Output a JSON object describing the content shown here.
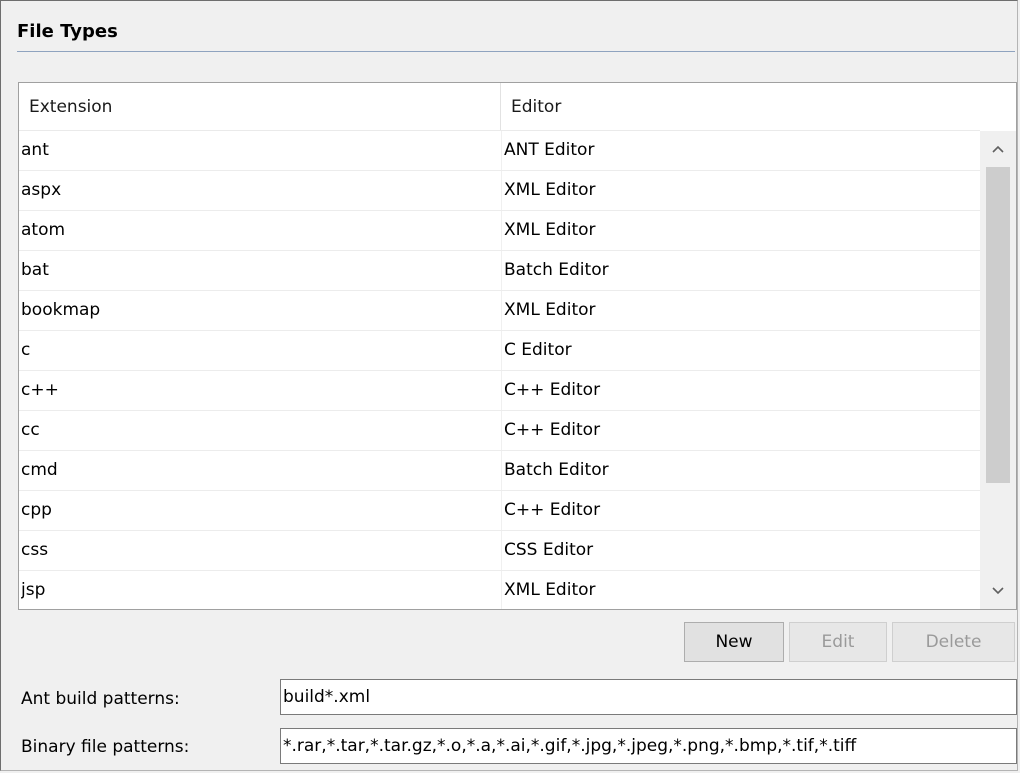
{
  "section": {
    "title": "File Types"
  },
  "table": {
    "columns": [
      "Extension",
      "Editor"
    ],
    "rows": [
      {
        "extension": "ant",
        "editor": "ANT Editor"
      },
      {
        "extension": "aspx",
        "editor": "XML Editor"
      },
      {
        "extension": "atom",
        "editor": "XML Editor"
      },
      {
        "extension": "bat",
        "editor": "Batch Editor"
      },
      {
        "extension": "bookmap",
        "editor": "XML Editor"
      },
      {
        "extension": "c",
        "editor": "C Editor"
      },
      {
        "extension": "c++",
        "editor": "C++ Editor"
      },
      {
        "extension": "cc",
        "editor": "C++ Editor"
      },
      {
        "extension": "cmd",
        "editor": "Batch Editor"
      },
      {
        "extension": "cpp",
        "editor": "C++ Editor"
      },
      {
        "extension": "css",
        "editor": "CSS Editor"
      },
      {
        "extension": "jsp",
        "editor": "XML Editor"
      }
    ]
  },
  "scrollbar": {
    "up_icon": "chevron-up-icon",
    "down_icon": "chevron-down-icon"
  },
  "buttons": {
    "new_label": "New",
    "edit_label": "Edit",
    "delete_label": "Delete"
  },
  "fields": {
    "ant_label": "Ant build patterns:",
    "ant_value": "build*.xml",
    "binary_label": "Binary file patterns:",
    "binary_value": "*.rar,*.tar,*.tar.gz,*.o,*.a,*.ai,*.gif,*.jpg,*.jpeg,*.png,*.bmp,*.tif,*.tiff"
  },
  "colors": {
    "background": "#f0f0f0",
    "rule": "#8fa3bf",
    "disabled_text": "#9a9a9a"
  }
}
